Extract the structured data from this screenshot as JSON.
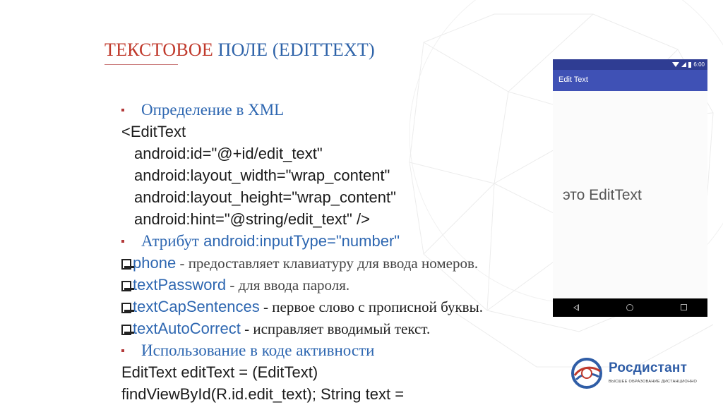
{
  "slide": {
    "title_part1": "ТЕКСТОВОЕ",
    "title_part2": "ПОЛЕ (EDITTEXT)"
  },
  "content": {
    "bullet1": "Определение в XML",
    "xml": [
      "<EditText",
      "android:id=\"@+id/edit_text\"",
      "android:layout_width=\"wrap_content\"",
      "android:layout_height=\"wrap_content\"",
      "android:hint=\"@string/edit_text\" />"
    ],
    "bullet2_label": "Атрибут",
    "bullet2_code": "android:inputType=\"number\"",
    "input_types": [
      {
        "name": "phone",
        "sep": " - ",
        "desc": "предоставляет клавиатуру для ввода номеров."
      },
      {
        "name": "textPassword",
        "sep": " - ",
        "desc": "для ввода пароля."
      },
      {
        "name": "textCapSentences",
        "sep": " - ",
        "desc": "первое слово с прописной буквы."
      },
      {
        "name": "textAutoCorrect",
        "sep": " - ",
        "desc": "исправляет вводимый текст."
      }
    ],
    "bullet3": "Использование в коде активности",
    "code_lines": [
      "EditText editText = (EditText)",
      "findViewById(R.id.edit_text); String text ="
    ]
  },
  "phone": {
    "time": "6:00",
    "app_title": "Edit Text",
    "edit_text_hint": "это EditText"
  },
  "logo": {
    "name": "Росдистант",
    "subtitle": "ВЫСШЕЕ ОБРАЗОВАНИЕ ДИСТАНЦИОННО",
    "colors": {
      "blue": "#2f5da6",
      "red": "#c0392b"
    }
  }
}
